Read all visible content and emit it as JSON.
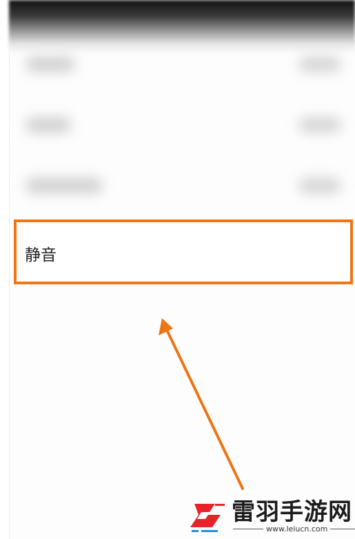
{
  "settings": {
    "highlighted_item_label": "静音"
  },
  "watermark": {
    "brand_name": "雷羽手游网",
    "url": "www.leiucn.com"
  },
  "colors": {
    "highlight": "#ef7414",
    "logo_red": "#e8242a",
    "logo_blue": "#1a8fe0"
  },
  "icons": {
    "brand_logo": "leiyu-logo-icon",
    "annotation": "arrow-up-icon"
  }
}
